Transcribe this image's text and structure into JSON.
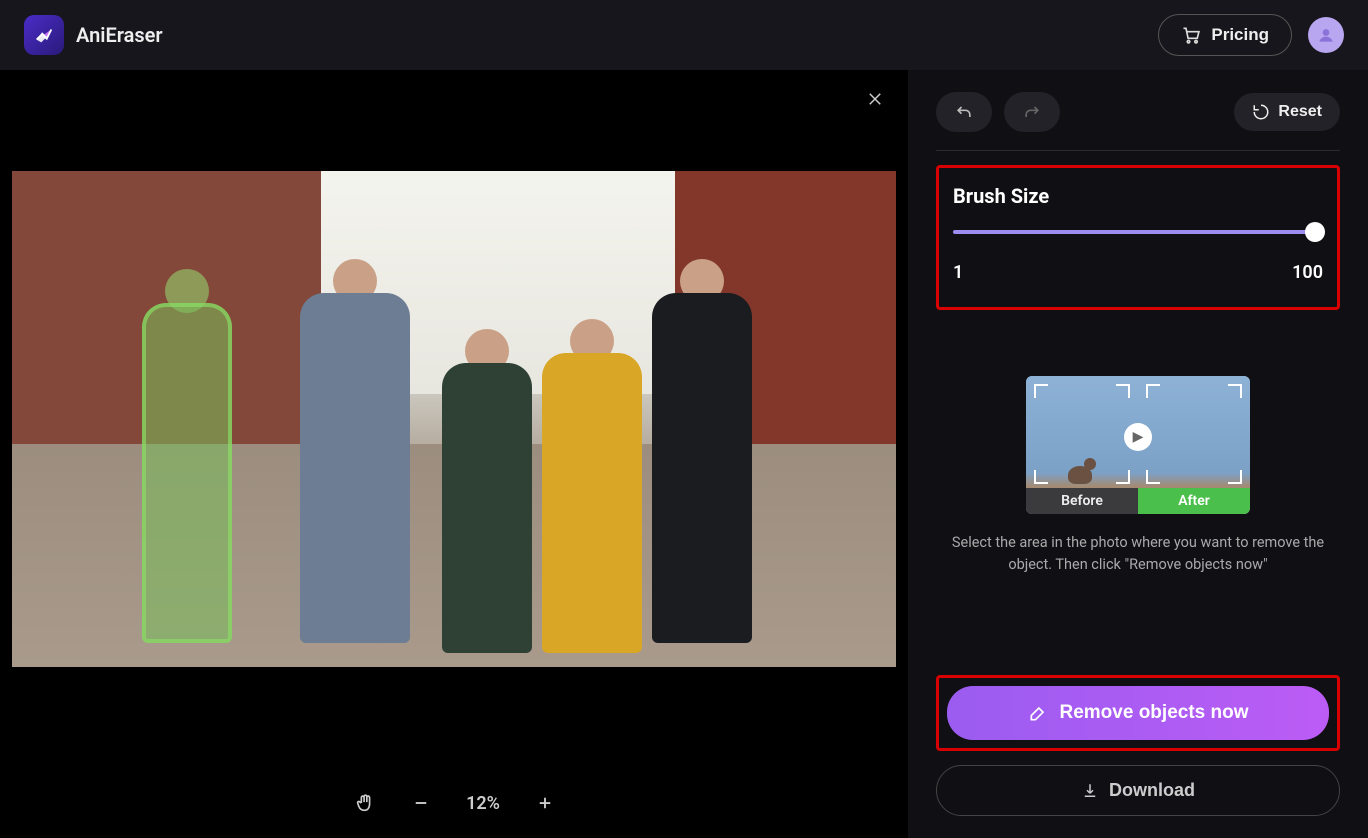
{
  "header": {
    "app_name": "AniEraser",
    "pricing_label": "Pricing"
  },
  "canvas": {
    "zoom_percent": "12%"
  },
  "sidebar": {
    "reset_label": "Reset",
    "brush": {
      "title": "Brush Size",
      "min": "1",
      "max": "100"
    },
    "preview": {
      "before_label": "Before",
      "after_label": "After"
    },
    "help_text": "Select the area in the photo where you want to remove the object. Then click \"Remove objects now\"",
    "remove_button": "Remove objects now",
    "download_button": "Download"
  },
  "colors": {
    "accent": "#9b5cf0",
    "highlight_border": "#d80000",
    "success": "#4bbf4b"
  }
}
